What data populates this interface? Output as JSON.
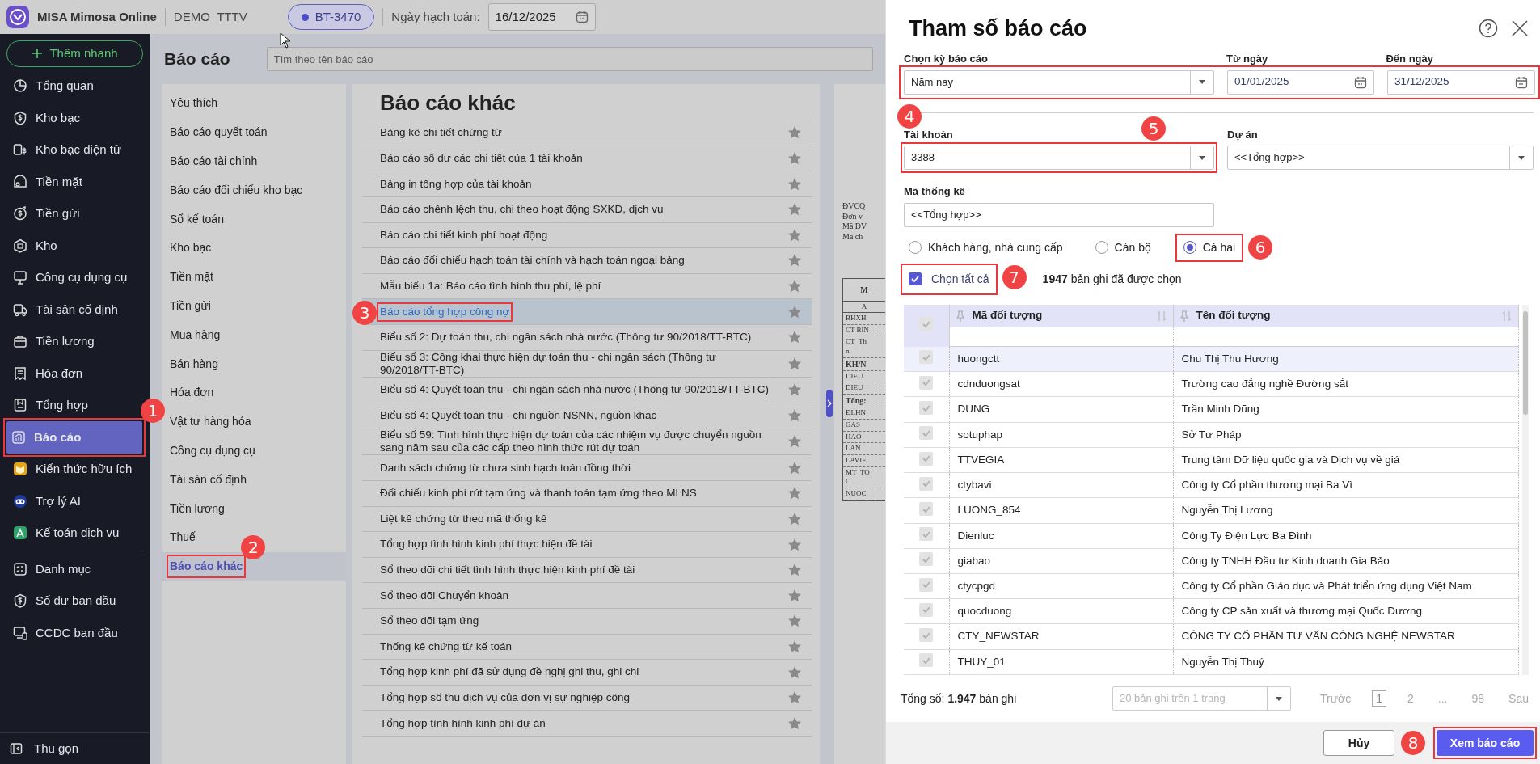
{
  "app": {
    "name": "MISA Mimosa Online",
    "unit": "DEMO_TTTV",
    "tenant": "BT-3470",
    "posting_date_label": "Ngày hạch toán:",
    "posting_date": "16/12/2025"
  },
  "sidebar": {
    "quick_add": "Thêm nhanh",
    "groups": [
      [
        {
          "label": "Tổng quan",
          "selected": false
        },
        {
          "label": "Kho bạc",
          "selected": false
        },
        {
          "label": "Kho bạc điện tử",
          "selected": false
        },
        {
          "label": "Tiền mặt",
          "selected": false
        },
        {
          "label": "Tiền gửi",
          "selected": false
        },
        {
          "label": "Kho",
          "selected": false
        },
        {
          "label": "Công cụ dụng cụ",
          "selected": false
        },
        {
          "label": "Tài sản cố định",
          "selected": false
        },
        {
          "label": "Tiền lương",
          "selected": false
        },
        {
          "label": "Hóa đơn",
          "selected": false
        },
        {
          "label": "Tổng hợp",
          "selected": false
        },
        {
          "label": "Báo cáo",
          "selected": true,
          "annotation": "1"
        },
        {
          "label": "Kiến thức hữu ích",
          "selected": false
        },
        {
          "label": "Trợ lý AI",
          "selected": false
        },
        {
          "label": "Kế toán dịch vụ",
          "selected": false
        }
      ],
      [
        {
          "label": "Danh mục",
          "selected": false
        },
        {
          "label": "Số dư ban đầu",
          "selected": false
        },
        {
          "label": "CCDC ban đầu",
          "selected": false
        }
      ]
    ],
    "collapse": "Thu gọn"
  },
  "page": {
    "title": "Báo cáo",
    "search_placeholder": "Tìm theo tên báo cáo"
  },
  "categories": [
    {
      "label": "Yêu thích",
      "selected": false
    },
    {
      "label": "Báo cáo quyết toán",
      "selected": false
    },
    {
      "label": "Báo cáo tài chính",
      "selected": false
    },
    {
      "label": "Báo cáo đối chiếu kho bạc",
      "selected": false
    },
    {
      "label": "Sổ kế toán",
      "selected": false
    },
    {
      "label": "Kho bạc",
      "selected": false
    },
    {
      "label": "Tiền mặt",
      "selected": false
    },
    {
      "label": "Tiền gửi",
      "selected": false
    },
    {
      "label": "Mua hàng",
      "selected": false
    },
    {
      "label": "Bán hàng",
      "selected": false
    },
    {
      "label": "Hóa đơn",
      "selected": false
    },
    {
      "label": "Vật tư hàng hóa",
      "selected": false
    },
    {
      "label": "Công cụ dụng cụ",
      "selected": false
    },
    {
      "label": "Tài sản cố định",
      "selected": false
    },
    {
      "label": "Tiền lương",
      "selected": false
    },
    {
      "label": "Thuế",
      "selected": false
    },
    {
      "label": "Báo cáo khác",
      "selected": true,
      "annotation": "2"
    }
  ],
  "reports": {
    "title": "Báo cáo khác",
    "items": [
      {
        "label": "Bảng kê chi tiết chứng từ",
        "selected": false,
        "starred": false
      },
      {
        "label": "Báo cáo số dư các chi tiết của 1 tài khoản",
        "selected": false,
        "starred": false
      },
      {
        "label": "Bảng in tổng hợp của tài khoản",
        "selected": false,
        "starred": false
      },
      {
        "label": "Báo cáo chênh lệch thu, chi theo hoạt động SXKD, dịch vụ",
        "selected": false,
        "starred": false
      },
      {
        "label": "Báo cáo chi tiết kinh phí hoạt động",
        "selected": false,
        "starred": false
      },
      {
        "label": "Báo cáo đối chiếu hạch toán tài chính và hạch toán ngoại bảng",
        "selected": false,
        "starred": false
      },
      {
        "label": "Mẫu biểu 1a: Báo cáo tình hình thu phí, lệ phí",
        "selected": false,
        "starred": false
      },
      {
        "label": "Báo cáo tổng hợp công nợ",
        "selected": true,
        "starred": false,
        "annotation": "3"
      },
      {
        "label": "Biểu số 2: Dự toán thu, chi ngân sách nhà nước (Thông tư 90/2018/TT-BTC)",
        "selected": false,
        "starred": false
      },
      {
        "label": "Biểu số 3: Công khai thực hiện dự toán thu - chi ngân sách (Thông tư 90/2018/TT-BTC)",
        "selected": false,
        "starred": false
      },
      {
        "label": "Biểu số 4: Quyết toán thu - chi ngân sách nhà nước (Thông tư 90/2018/TT-BTC)",
        "selected": false,
        "starred": false
      },
      {
        "label": "Biểu số 4: Quyết toán thu - chi nguồn NSNN, nguồn khác",
        "selected": false,
        "starred": false
      },
      {
        "label": "Biểu số 59: Tình hình thực hiện dự toán của các nhiệm vụ được chuyển nguồn sang năm sau của các cấp theo hình thức rút dự toán",
        "selected": false,
        "starred": false
      },
      {
        "label": "Danh sách chứng từ chưa sinh hạch toán đồng thời",
        "selected": false,
        "starred": false
      },
      {
        "label": "Đối chiếu kinh phí rút tạm ứng và thanh toán tạm ứng theo MLNS",
        "selected": false,
        "starred": false
      },
      {
        "label": "Liệt kê chứng từ theo mã thống kê",
        "selected": false,
        "starred": false
      },
      {
        "label": "Tổng hợp tình hình kinh phí thực hiện đề tài",
        "selected": false,
        "starred": false
      },
      {
        "label": "Sổ theo dõi chi tiết tình hình thực hiện kinh phí đề tài",
        "selected": false,
        "starred": false
      },
      {
        "label": "Sổ theo dõi Chuyển khoản",
        "selected": false,
        "starred": false
      },
      {
        "label": "Sổ theo dõi tạm ứng",
        "selected": false,
        "starred": false
      },
      {
        "label": "Thống kê chứng từ kế toán",
        "selected": false,
        "starred": false
      },
      {
        "label": "Tổng hợp kinh phí đã sử dụng đề nghị ghi thu, ghi chi",
        "selected": false,
        "starred": false
      },
      {
        "label": "Tổng hợp số thu dịch vụ của đơn vị sự nghiệp công",
        "selected": false,
        "starred": false
      },
      {
        "label": "Tổng hợp tình hình kinh phí dự án",
        "selected": false,
        "starred": false
      }
    ]
  },
  "preview": {
    "header_lines": [
      "ĐVCQ",
      "Đơn v",
      "Mã ĐV",
      "Mã ch"
    ],
    "table_header": [
      "M",
      "A"
    ],
    "rows": [
      {
        "text": "BHXH",
        "bold": false
      },
      {
        "text": "CT BIN",
        "bold": false
      },
      {
        "text": "CT_Th\nn",
        "bold": false
      },
      {
        "text": "KH/N",
        "bold": true
      },
      {
        "text": "DIEU",
        "bold": false
      },
      {
        "text": "DIEU",
        "bold": false
      },
      {
        "text": "Tổng:",
        "bold": true
      },
      {
        "text": "ĐLHN",
        "bold": false
      },
      {
        "text": "GAS",
        "bold": false
      },
      {
        "text": "HAO",
        "bold": false
      },
      {
        "text": "LAN",
        "bold": false
      },
      {
        "text": "LAVIE",
        "bold": false
      },
      {
        "text": "MT_TO\nC",
        "bold": false
      },
      {
        "text": "NUOC_",
        "bold": false
      }
    ]
  },
  "dialog": {
    "title": "Tham số báo cáo",
    "period": {
      "annotation": "4",
      "period_label": "Chọn kỳ báo cáo",
      "period_value": "Năm nay",
      "from_label": "Từ ngày",
      "from_value": "01/01/2025",
      "to_label": "Đến ngày",
      "to_value": "31/12/2025"
    },
    "account": {
      "label": "Tài khoản",
      "value": "3388",
      "annotation": "5"
    },
    "project": {
      "label": "Dự án",
      "value": "<<Tổng hợp>>"
    },
    "stat_code": {
      "label": "Mã thống kê",
      "value": "<<Tổng hợp>>"
    },
    "object_types": [
      {
        "label": "Khách hàng, nhà cung cấp",
        "selected": false
      },
      {
        "label": "Cán bộ",
        "selected": false
      },
      {
        "label": "Cả hai",
        "selected": true,
        "annotation": "6"
      }
    ],
    "select_all": {
      "label": "Chọn tất cả",
      "checked": true,
      "annotation": "7"
    },
    "selected_count": "**1947** bản ghi đã được chọn",
    "table": {
      "header_checked": true,
      "columns": [
        "Mã đối tượng",
        "Tên đối tượng"
      ],
      "rows": [
        {
          "code": "huongctt",
          "name": "Chu Thị Thu Hương",
          "checked": true,
          "selected": true
        },
        {
          "code": "cdnduongsat",
          "name": "Trường cao đẳng nghề Đường sắt",
          "checked": true,
          "selected": false
        },
        {
          "code": "DUNG",
          "name": "Trần Minh Dũng",
          "checked": true,
          "selected": false
        },
        {
          "code": "sotuphap",
          "name": "Sở Tư Pháp",
          "checked": true,
          "selected": false
        },
        {
          "code": "TTVEGIA",
          "name": "Trung tâm Dữ liệu quốc gia và Dịch vụ về giá",
          "checked": true,
          "selected": false
        },
        {
          "code": "ctybavi",
          "name": "Công ty Cổ phần thương mại Ba Vì",
          "checked": true,
          "selected": false
        },
        {
          "code": "LUONG_854",
          "name": "Nguyễn Thị Lương",
          "checked": true,
          "selected": false
        },
        {
          "code": "Dienluc",
          "name": "Công Ty Điện Lực Ba Đình",
          "checked": true,
          "selected": false
        },
        {
          "code": "giabao",
          "name": "Công ty TNHH Đầu tư Kinh doanh Gia Bảo",
          "checked": true,
          "selected": false
        },
        {
          "code": "ctycpgd",
          "name": "Công ty Cổ phần Giáo dục và Phát triển ứng dụng Việt Nam",
          "checked": true,
          "selected": false
        },
        {
          "code": "quocduong",
          "name": "Công ty CP sản xuất và thương mại Quốc Dương",
          "checked": true,
          "selected": false
        },
        {
          "code": "CTY_NEWSTAR",
          "name": "CÔNG TY CỔ PHẦN TƯ VẤN CÔNG NGHỆ NEWSTAR",
          "checked": true,
          "selected": false
        },
        {
          "code": "THUY_01",
          "name": "Nguyễn Thị Thuý",
          "checked": true,
          "selected": false
        }
      ]
    },
    "total": "Tổng số: **1.947** bản ghi",
    "page_size": "20 bản ghi trên 1 trang",
    "pager": {
      "prev": "Trước",
      "pages": [
        {
          "label": "1",
          "selected": true
        },
        {
          "label": "2",
          "selected": false
        },
        {
          "label": "...",
          "selected": false
        },
        {
          "label": "98",
          "selected": false
        }
      ],
      "next": "Sau"
    },
    "cancel": "Hủy",
    "submit": "Xem báo cáo",
    "submit_annotation": "8"
  }
}
